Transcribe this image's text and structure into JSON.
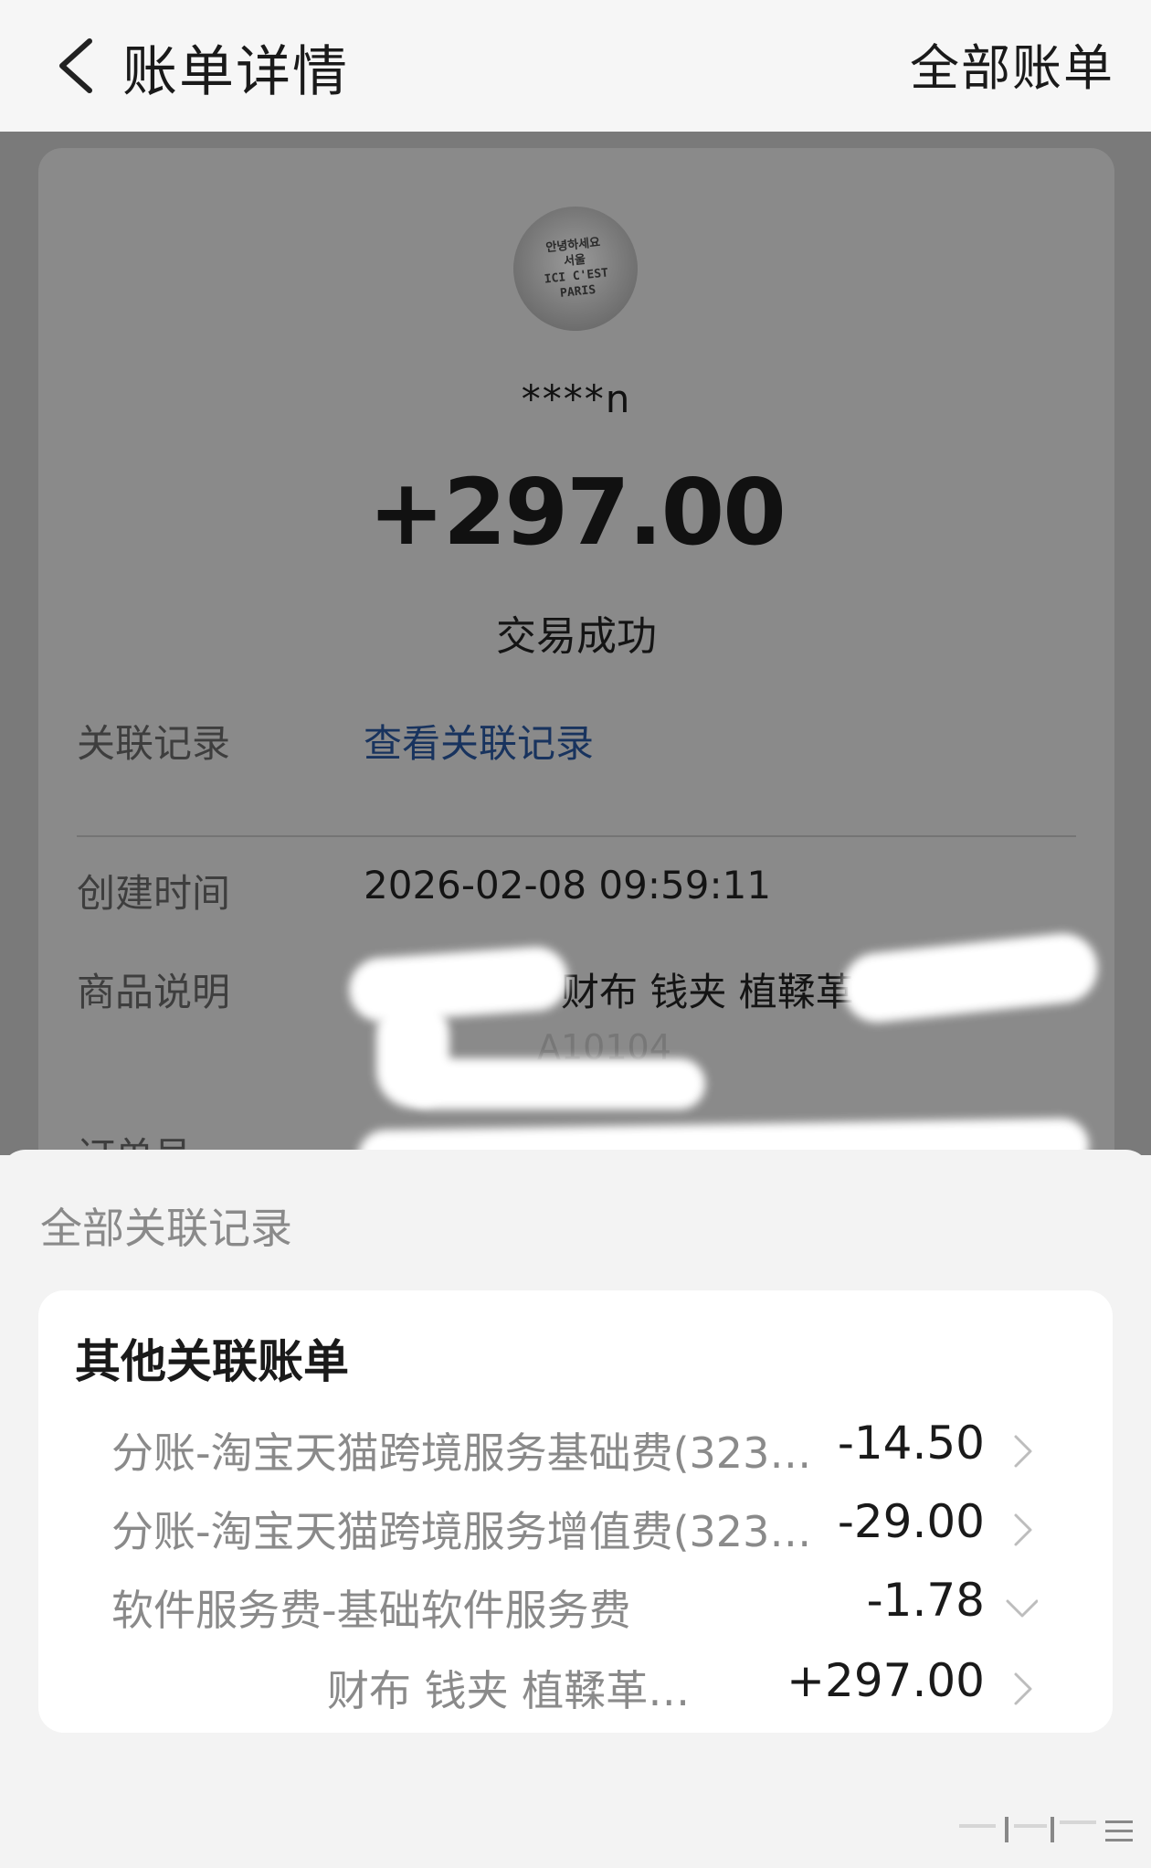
{
  "header": {
    "title": "账单详情",
    "right_action": "全部账单"
  },
  "detail": {
    "avatar_text": [
      "안녕하세요",
      "서울",
      "ICI C'EST",
      "PARIS"
    ],
    "username": "****n",
    "amount": "+297.00",
    "status": "交易成功",
    "rows": [
      {
        "label": "关联记录",
        "value": "查看关联记录"
      },
      {
        "label": "创建时间",
        "value": "2026-02-08 09:59:11"
      },
      {
        "label": "商品说明",
        "value": "财布 钱夹 植鞣革"
      },
      {
        "label": "订单号",
        "value": ""
      }
    ],
    "partial_text": "A10104"
  },
  "sheet": {
    "title": "全部关联记录",
    "card_heading": "其他关联账单",
    "items": [
      {
        "name": "分账-淘宝天猫跨境服务基础费(323…",
        "amount": "-14.50"
      },
      {
        "name": "分账-淘宝天猫跨境服务增值费(323…",
        "amount": "-29.00"
      },
      {
        "name": "软件服务费-基础软件服务费",
        "amount": "-1.78"
      },
      {
        "name": "财布 钱夹 植鞣革…",
        "amount": "+297.00"
      }
    ]
  },
  "colors": {
    "link": "#18335e",
    "overlay": "#7a7a7a",
    "sheet_bg": "#f3f3f3"
  }
}
